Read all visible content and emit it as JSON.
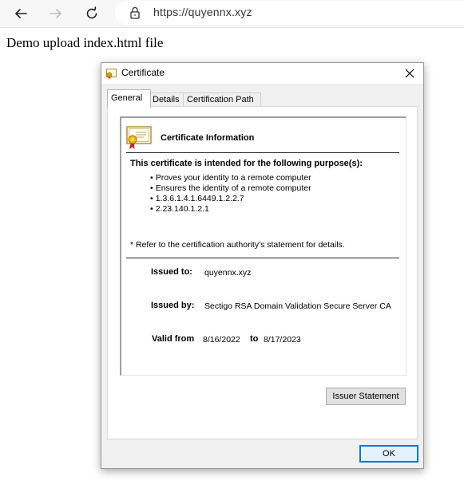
{
  "browser": {
    "url": "https://quyennx.xyz"
  },
  "page": {
    "heading": "Demo upload index.html file"
  },
  "dialog": {
    "title": "Certificate",
    "tabs": [
      {
        "label": "General"
      },
      {
        "label": "Details"
      },
      {
        "label": "Certification Path"
      }
    ],
    "info_title": "Certificate Information",
    "purpose_heading": "This certificate is intended for the following purpose(s):",
    "purposes": [
      "Proves your identity to a remote computer",
      "Ensures the identity of a remote computer",
      "1.3.6.1.4.1.6449.1.2.2.7",
      "2.23.140.1.2.1"
    ],
    "footnote": "* Refer to the certification authority's statement for details.",
    "issued_to_label": "Issued to:",
    "issued_to_value": "quyennx.xyz",
    "issued_by_label": "Issued by:",
    "issued_by_value": "Sectigo RSA Domain Validation Secure Server CA",
    "valid_from_label": "Valid from",
    "valid_from_value": "8/16/2022",
    "valid_to_label": "to",
    "valid_to_value": "8/17/2023",
    "issuer_statement_label": "Issuer Statement",
    "ok_label": "OK"
  },
  "colors": {
    "focus_border": "#0078d7",
    "dialog_bg": "#f0f0f0"
  },
  "icons": [
    "back-arrow-icon",
    "forward-arrow-icon",
    "refresh-icon",
    "lock-icon",
    "certificate-icon",
    "close-icon"
  ]
}
